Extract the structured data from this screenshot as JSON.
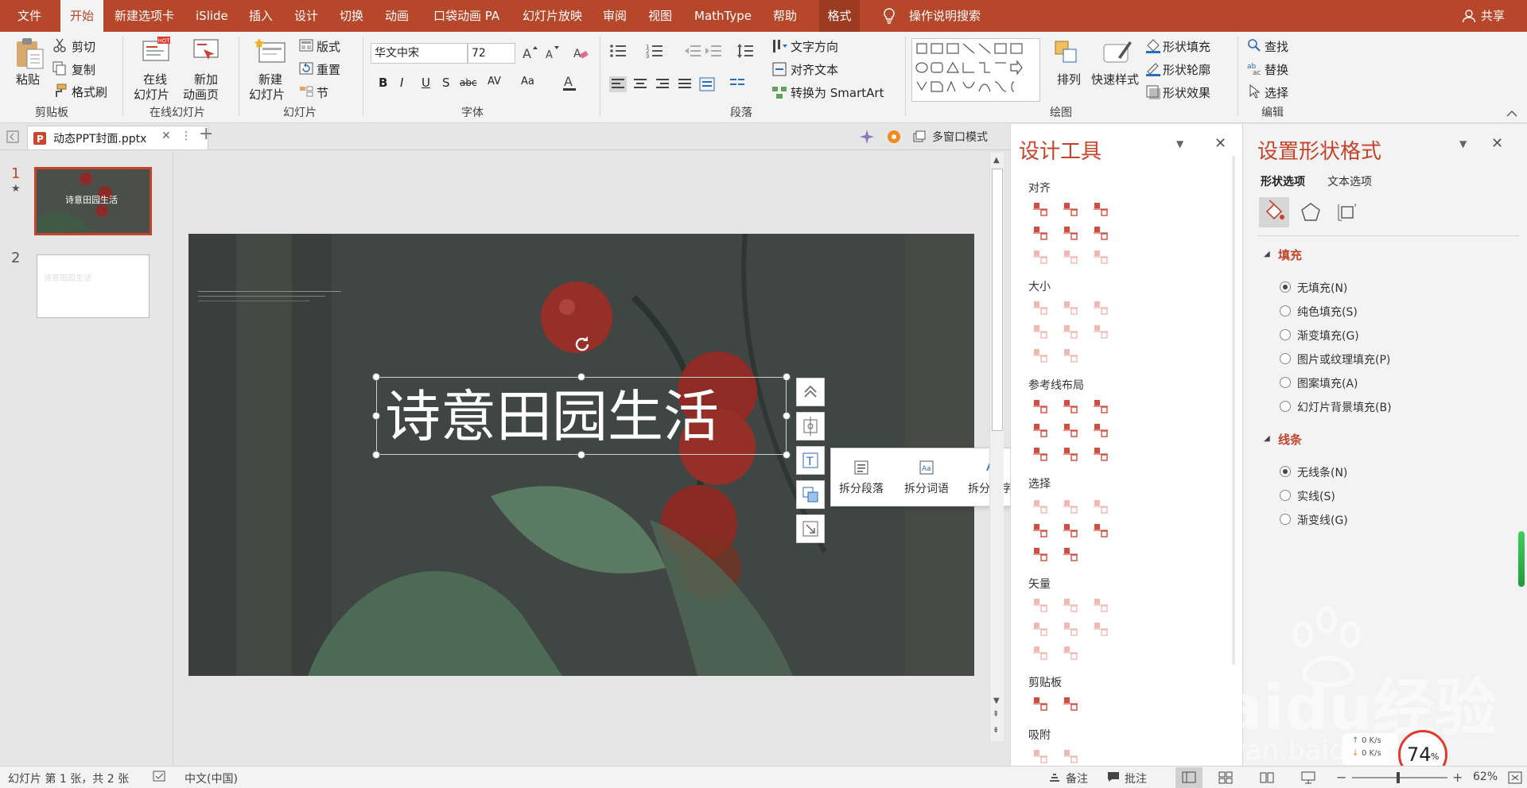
{
  "menu": {
    "file": "文件",
    "home": "开始",
    "new_tab": "新建选项卡",
    "islide": "iSlide",
    "insert": "插入",
    "design": "设计",
    "transitions": "切换",
    "animations": "动画",
    "pocket_anim": "口袋动画 PA",
    "slideshow": "幻灯片放映",
    "review": "审阅",
    "view": "视图",
    "mathtype": "MathType",
    "help": "帮助",
    "format": "格式",
    "tell_me": "操作说明搜索",
    "share": "共享"
  },
  "ribbon": {
    "clipboard": {
      "paste": "粘贴",
      "cut": "剪切",
      "copy": "复制",
      "format_painter": "格式刷",
      "label": "剪贴板"
    },
    "online": {
      "online_slides": "在线",
      "online_slides2": "幻灯片",
      "new_anim": "新加",
      "new_anim2": "动画页",
      "hot": "HOT",
      "label": "在线幻灯片"
    },
    "slides": {
      "new_slide": "新建",
      "new_slide2": "幻灯片",
      "layout": "版式",
      "reset": "重置",
      "section": "节",
      "label": "幻灯片"
    },
    "font": {
      "name": "华文中宋",
      "size": "72",
      "label": "字体"
    },
    "paragraph": {
      "text_direction": "文字方向",
      "align_text": "对齐文本",
      "smartart": "转换为 SmartArt",
      "label": "段落"
    },
    "drawing": {
      "arrange": "排列",
      "quick_styles": "快速样式",
      "shape_fill": "形状填充",
      "shape_outline": "形状轮廓",
      "shape_effects": "形状效果",
      "label": "绘图"
    },
    "editing": {
      "find": "查找",
      "replace": "替换",
      "select": "选择",
      "label": "编辑"
    }
  },
  "tabstrip": {
    "doc_name": "动态PPT封面.pptx",
    "multi_window": "多窗口模式"
  },
  "thumbnails": [
    {
      "number": "1",
      "star": "★",
      "title": "诗意田园生活"
    },
    {
      "number": "2",
      "title": "诗意田园生活"
    }
  ],
  "slide": {
    "title": "诗意田园生活"
  },
  "split_popup": {
    "paragraph": "拆分段落",
    "words": "拆分词语",
    "chars": "拆分单字"
  },
  "design_panel": {
    "title": "设计工具",
    "sections": {
      "align": "对齐",
      "size": "大小",
      "guides": "参考线布局",
      "select": "选择",
      "vector": "矢量",
      "clipboard": "剪贴板",
      "snap": "吸附"
    }
  },
  "format_panel": {
    "title": "设置形状格式",
    "tab_shape": "形状选项",
    "tab_text": "文本选项",
    "fill_header": "填充",
    "fill_options": [
      "无填充(N)",
      "纯色填充(S)",
      "渐变填充(G)",
      "图片或纹理填充(P)",
      "图案填充(A)",
      "幻灯片背景填充(B)"
    ],
    "line_header": "线条",
    "line_options": [
      "无线条(N)",
      "实线(S)",
      "渐变线(G)"
    ]
  },
  "status": {
    "slide_info": "幻灯片 第 1 张，共 2 张",
    "language": "中文(中国)",
    "notes": "备注",
    "comments": "批注",
    "zoom": "62%",
    "net_up": "0 K/s",
    "net_down": "0 K/s",
    "cpu": "74",
    "cpu_unit": "%"
  },
  "watermark": {
    "brand": "Baidu经验",
    "url": "jingyan.baidu.com"
  },
  "colors": {
    "accent": "#b7472a",
    "panel_title": "#c4432b",
    "icon_red": "#d24d3f"
  }
}
